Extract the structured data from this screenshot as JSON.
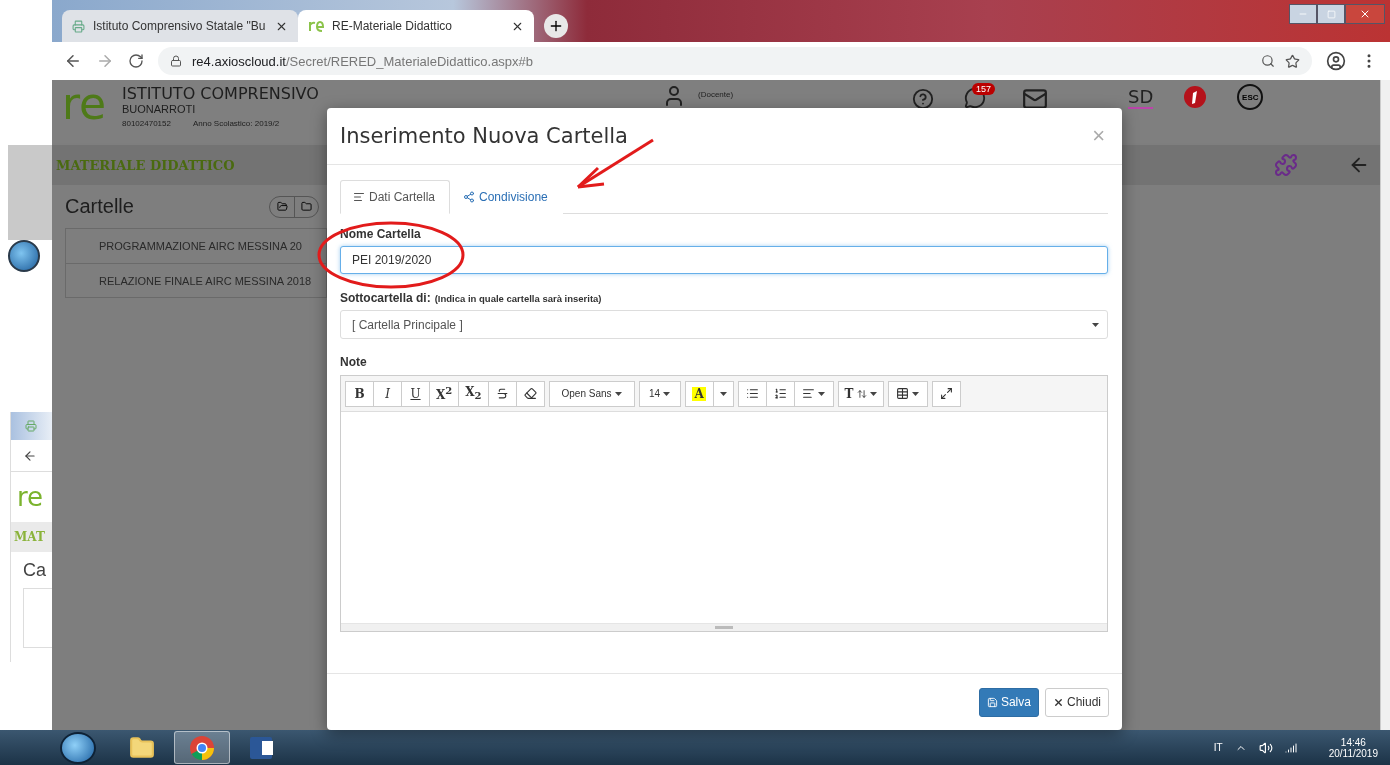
{
  "browser": {
    "tabs": [
      {
        "title": "Istituto Comprensivo Statale \"Bu",
        "selected": false
      },
      {
        "title": "RE-Materiale Didattico",
        "selected": true
      }
    ],
    "url_domain": "re4.axioscloud.it",
    "url_path": "/Secret/RERED_MaterialeDidattico.aspx#b"
  },
  "background_window": {
    "logo": "re",
    "header": "MAT",
    "title": "Ca"
  },
  "header": {
    "logo": "re",
    "school": "ISTITUTO COMPRENSIVO",
    "school_name": "BUONARROTI",
    "code": "80102470152",
    "year": "Anno Scolastico: 2019/2",
    "role": "(Docente)",
    "badge": "157",
    "shortcuts": [
      "SD",
      "ESC"
    ]
  },
  "section": {
    "title": "MATERIALE DIDATTICO"
  },
  "folders": {
    "title": "Cartelle",
    "items": [
      "PROGRAMMAZIONE AIRC MESSINA 20",
      "RELAZIONE FINALE AIRC MESSINA 2018"
    ]
  },
  "modal": {
    "title": "Inserimento Nuova Cartella",
    "close": "×",
    "tabs": [
      {
        "label": "Dati Cartella",
        "selected": true
      },
      {
        "label": "Condivisione",
        "selected": false
      }
    ],
    "name_label": "Nome Cartella",
    "name_value": "PEI 2019/2020",
    "parent_label": "Sottocartella di:",
    "parent_hint": "(Indica in quale cartella sarà inserita)",
    "parent_value": "[ Cartella Principale ]",
    "notes_label": "Note",
    "toolbar": [
      [
        {
          "kind": "bold",
          "label": "B"
        },
        {
          "kind": "italic",
          "label": "I"
        },
        {
          "kind": "underline",
          "label": "U"
        },
        {
          "kind": "superscript",
          "label": "X$^{2}$"
        },
        {
          "kind": "subscript",
          "label": "X$_{2}$"
        },
        {
          "kind": "strike"
        },
        {
          "kind": "eraser"
        }
      ],
      [
        {
          "kind": "font",
          "label": "Open Sans"
        }
      ],
      [
        {
          "kind": "size",
          "label": "14"
        }
      ],
      [
        {
          "kind": "highlight",
          "label": "A"
        },
        {
          "kind": "caret"
        }
      ],
      [
        {
          "kind": "bullets"
        },
        {
          "kind": "numbers"
        },
        {
          "kind": "align"
        }
      ],
      [
        {
          "kind": "lineheight",
          "label": "T"
        }
      ],
      [
        {
          "kind": "table"
        }
      ],
      [
        {
          "kind": "fullscreen"
        }
      ]
    ],
    "buttons": [
      {
        "label": "Salva",
        "kind": "primary"
      },
      {
        "label": "Chiudi",
        "kind": "default"
      }
    ]
  },
  "taskbar": {
    "apps": [
      {
        "kind": "folder",
        "selected": false
      },
      {
        "kind": "chrome",
        "selected": true
      },
      {
        "kind": "word",
        "selected": false
      }
    ],
    "language": "IT",
    "time": "14:46",
    "date": "20/11/2019"
  }
}
